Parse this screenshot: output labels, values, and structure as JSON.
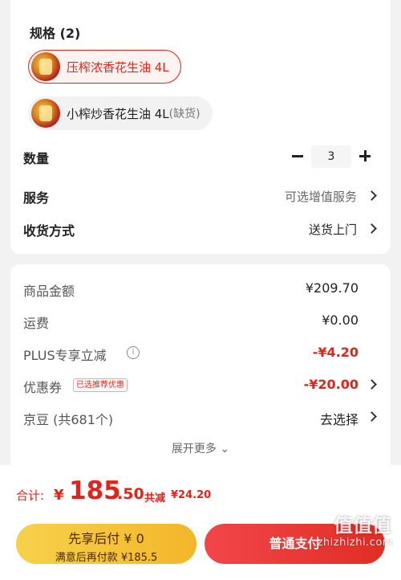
{
  "spec": {
    "title": "规格 (2)",
    "options": [
      {
        "name": "压榨浓香花生油 4L",
        "suffix": "",
        "selected": true
      },
      {
        "name": "小榨炒香花生油 4L",
        "suffix": "(缺货)",
        "selected": false
      }
    ]
  },
  "quantity": {
    "label": "数量",
    "value": "3"
  },
  "service": {
    "label": "服务",
    "value": "可选增值服务"
  },
  "delivery": {
    "label": "收货方式",
    "value": "送货上门"
  },
  "fees": {
    "goods": {
      "label": "商品金额",
      "value": "¥209.70"
    },
    "shipping": {
      "label": "运费",
      "value": "¥0.00"
    },
    "plus": {
      "label": "PLUS专享立减",
      "value": "-¥4.20"
    },
    "coupon": {
      "label": "优惠券",
      "badge": "已选推荐优惠",
      "value": "-¥20.00"
    },
    "jingdou": {
      "label": "京豆 (共681个)",
      "value": "去选择"
    },
    "expand": "展开更多 ⌄"
  },
  "total": {
    "label": "合计:",
    "yen": "¥",
    "int": "185",
    "dec": ".50",
    "save_label": "共减",
    "save_value": "¥24.20"
  },
  "buttons": {
    "paylater_line1": "先享后付 ¥ 0",
    "paylater_line2": "满意后再付款 ¥185.5",
    "submit": "普通支付"
  },
  "watermark": {
    "glyph": "值值值",
    "text": "zhizhizhi.com"
  },
  "colors": {
    "accent": "#e2231a",
    "paylater": "#f5c83a",
    "submit": "#e8383d"
  }
}
